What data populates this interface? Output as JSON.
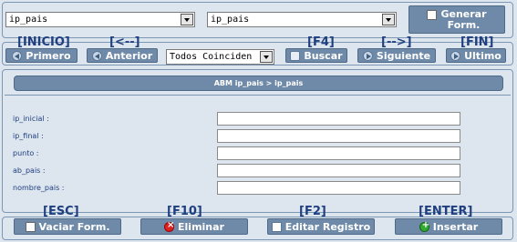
{
  "top": {
    "table_select": "ip_pais",
    "field_select": "ip_pais",
    "generate_button": "Generar Form."
  },
  "nav": {
    "keys": {
      "first": "[INICIO]",
      "prev": "[<--]",
      "search": "[F4]",
      "next": "[-->]",
      "last": "[FIN]"
    },
    "first": "Primero",
    "prev": "Anterior",
    "filter_select": "Todos Coinciden",
    "search": "Buscar",
    "next": "Siguiente",
    "last": "Ultimo"
  },
  "form": {
    "title": "ABM ip_pais > ip_pais",
    "fields": [
      {
        "label": "ip_inicial :",
        "value": ""
      },
      {
        "label": "ip_final :",
        "value": ""
      },
      {
        "label": "punto :",
        "value": ""
      },
      {
        "label": "ab_pais :",
        "value": ""
      },
      {
        "label": "nombre_pais :",
        "value": ""
      }
    ]
  },
  "actions": {
    "keys": {
      "clear": "[ESC]",
      "delete": "[F10]",
      "edit": "[F2]",
      "insert": "[ENTER]"
    },
    "clear": "Vaciar Form.",
    "delete": "Eliminar",
    "edit": "Editar Registro",
    "insert": "Insertar"
  },
  "colors": {
    "button": "#6e8aa8",
    "background": "#dde5ee",
    "key_text": "#1f3f7f"
  },
  "icons": {
    "first": "first-icon",
    "prev": "prev-icon",
    "search": "search-icon",
    "next": "next-icon",
    "last": "last-icon",
    "clear": "form-icon",
    "delete": "delete-icon",
    "edit": "edit-icon",
    "insert": "add-icon",
    "generate": "form-icon"
  }
}
